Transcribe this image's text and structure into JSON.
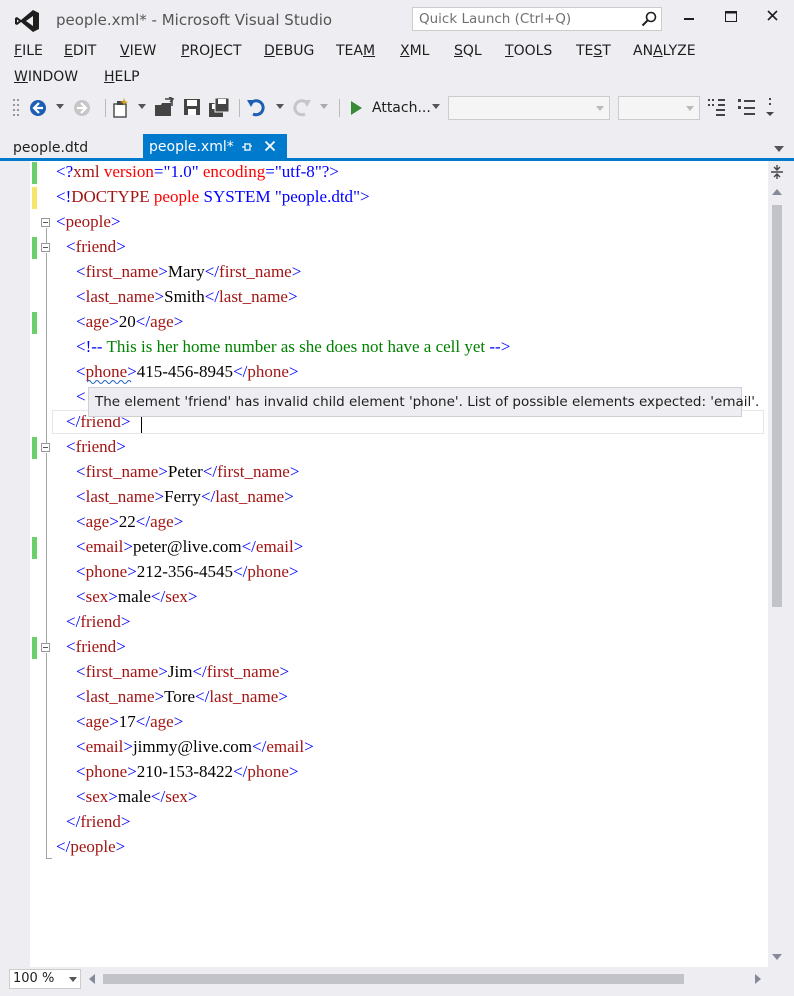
{
  "window": {
    "title": "people.xml* - Microsoft Visual Studio",
    "quick_launch_placeholder": "Quick Launch (Ctrl+Q)"
  },
  "menu": {
    "row1": [
      "FILE",
      "EDIT",
      "VIEW",
      "PROJECT",
      "DEBUG",
      "TEAM",
      "XML",
      "SQL",
      "TOOLS",
      "TEST",
      "ANALYZE"
    ],
    "row2": [
      "WINDOW",
      "HELP"
    ]
  },
  "toolbar": {
    "attach_label": "Attach...",
    "icons": [
      "back-icon",
      "forward-icon",
      "new-project-icon",
      "open-file-icon",
      "save-icon",
      "save-all-icon",
      "undo-icon",
      "redo-icon",
      "start-icon"
    ]
  },
  "tabs": [
    {
      "label": "people.dtd",
      "active": false
    },
    {
      "label": "people.xml*",
      "active": true
    }
  ],
  "editor": {
    "lines": [
      "<?xml version=\"1.0\" encoding=\"utf-8\"?>",
      "<!DOCTYPE people SYSTEM \"people.dtd\">",
      "<people>",
      "<friend>",
      "<first_name>Mary</first_name>",
      "<last_name>Smith</last_name>",
      "<age>20</age>",
      "<!-- This is her home number as she does not have a cell yet -->",
      "<phone>415-456-8945</phone>",
      "<",
      "</friend>",
      "<friend>",
      "<first_name>Peter</first_name>",
      "<last_name>Ferry</last_name>",
      "<age>22</age>",
      "<email>peter@live.com</email>",
      "<phone>212-356-4545</phone>",
      "<sex>male</sex>",
      "</friend>",
      "<friend>",
      "<first_name>Jim</first_name>",
      "<last_name>Tore</last_name>",
      "<age>17</age>",
      "<email>jimmy@live.com</email>",
      "<phone>210-153-8422</phone>",
      "<sex>male</sex>",
      "</friend>",
      "</people>"
    ],
    "tooltip": "The element 'friend' has invalid child element 'phone'. List of possible elements expected: 'email'."
  },
  "status": {
    "zoom": "100 %"
  },
  "colors": {
    "accent": "#007acc",
    "tag": "#a31515",
    "bracket": "#0000ff",
    "attribute": "#ff0000",
    "comment": "#008000",
    "change_mark": "#6bd06b",
    "unsaved_mark": "#f5e56b"
  }
}
